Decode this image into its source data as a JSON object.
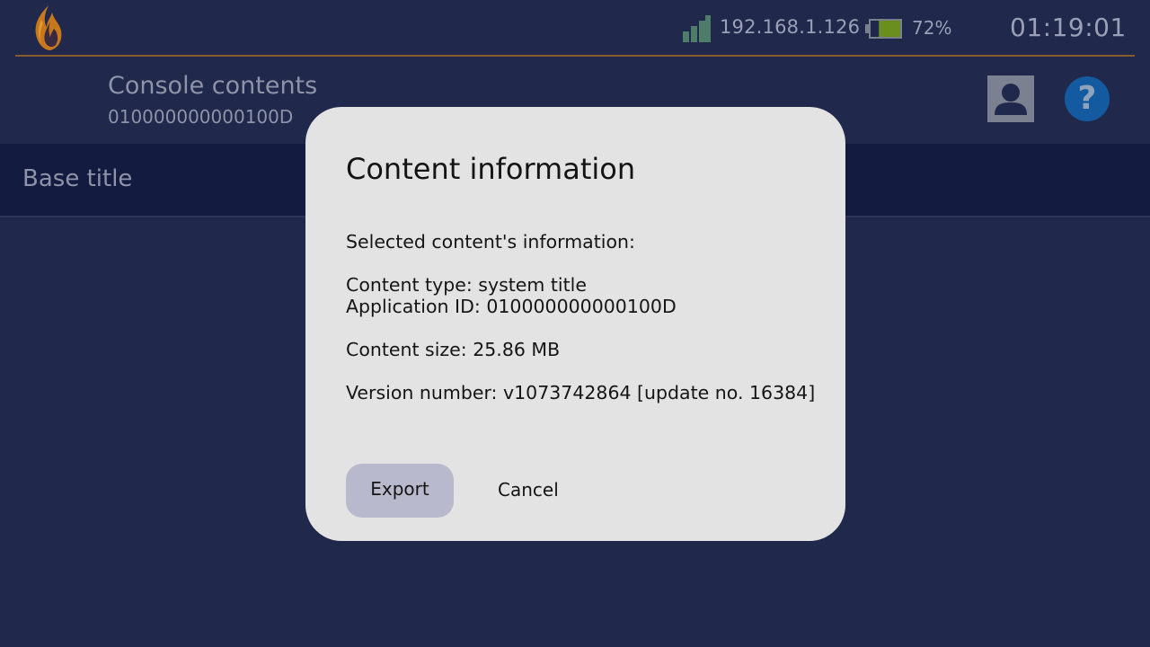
{
  "status_bar": {
    "ip_address": "192.168.1.126",
    "battery_percent": "72%",
    "battery_level": 0.72,
    "battery_color": "#6b8f1e",
    "time": "01:19:01",
    "signal_color": "#4f7d6a",
    "accent_line_color": "#8a5a30"
  },
  "header": {
    "title": "Console contents",
    "subtitle": "010000000000100D",
    "user_icon": "user-avatar-icon",
    "help_icon": "help-icon",
    "help_glyph": "?"
  },
  "tabs": {
    "active_label": "Base title"
  },
  "dialog": {
    "title": "Content information",
    "lines": {
      "intro": "Selected content's information:",
      "content_type": "Content type: system title",
      "application_id": "Application ID: 010000000000100D",
      "content_size": "Content size: 25.86 MB",
      "version": "Version number: v1073742864 [update no. 16384]"
    },
    "buttons": {
      "export": "Export",
      "cancel": "Cancel"
    }
  },
  "colors": {
    "background": "#20284c",
    "tab_band": "#141b40",
    "dialog_background": "#e3e3e3",
    "export_button": "#b9b9cd",
    "help_button": "#145aa0"
  }
}
